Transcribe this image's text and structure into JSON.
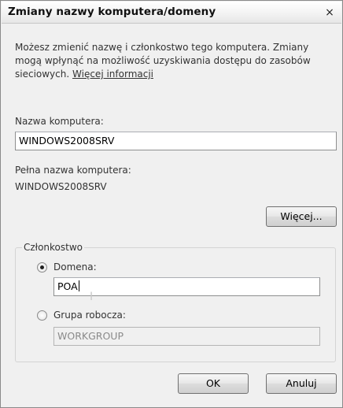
{
  "window": {
    "title": "Zmiany nazwy komputera/domeny",
    "close_label": "×"
  },
  "description": {
    "text": "Możesz zmienić nazwę i członkostwo tego komputera. Zmiany mogą wpłynąć na możliwość uzyskiwania dostępu do zasobów sieciowych.",
    "link": "Więcej informacji"
  },
  "computer_name": {
    "label": "Nazwa komputera:",
    "value": "WINDOWS2008SRV"
  },
  "full_name": {
    "label": "Pełna nazwa komputera:",
    "value": "WINDOWS2008SRV"
  },
  "more_button": "Więcej...",
  "membership": {
    "legend": "Członkostwo",
    "domain_label": "Domena:",
    "domain_value": "POA",
    "domain_selected": true,
    "workgroup_label": "Grupa robocza:",
    "workgroup_value": "WORKGROUP"
  },
  "buttons": {
    "ok": "OK",
    "cancel": "Anuluj"
  }
}
